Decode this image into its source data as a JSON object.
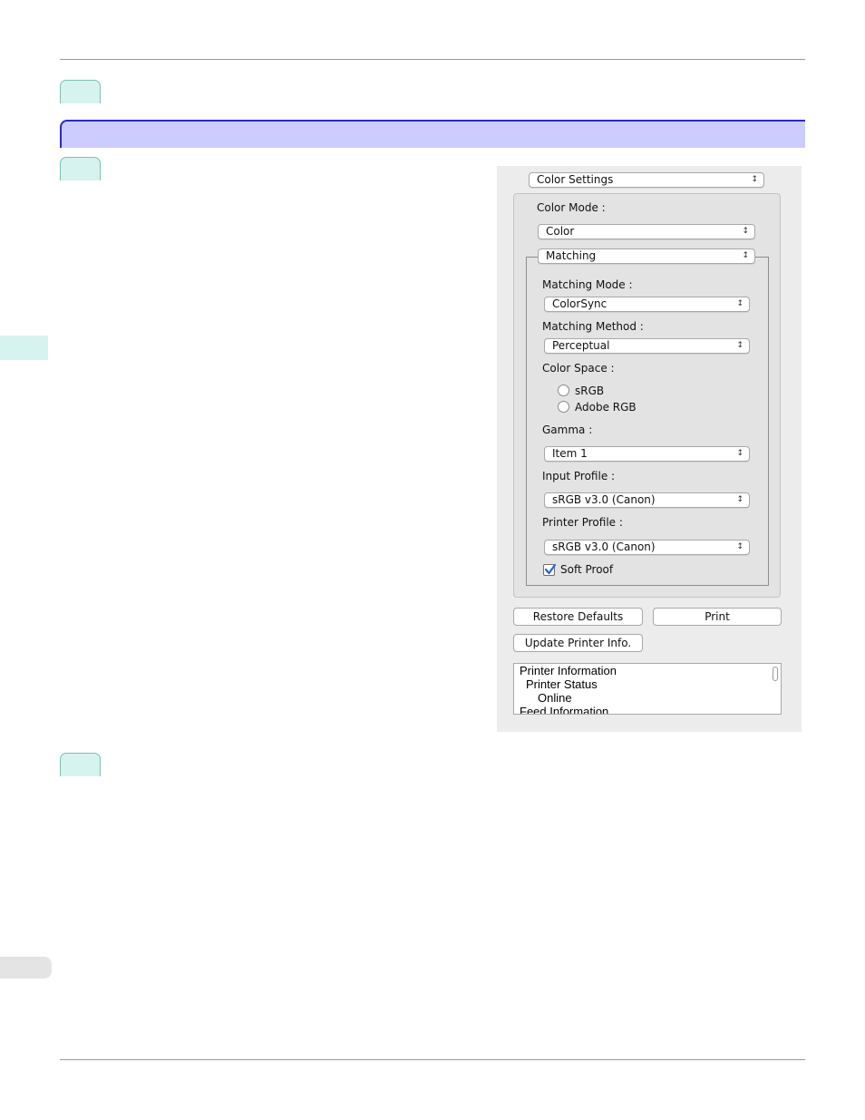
{
  "dialog": {
    "settings_menu": "Color Settings",
    "color_mode_label": "Color Mode :",
    "color_mode_value": "Color",
    "matching_menu": "Matching",
    "matching_mode_label": "Matching Mode :",
    "matching_mode_value": "ColorSync",
    "matching_method_label": "Matching Method :",
    "matching_method_value": "Perceptual",
    "color_space_label": "Color Space :",
    "color_space_options": [
      "sRGB",
      "Adobe RGB"
    ],
    "gamma_label": "Gamma :",
    "gamma_value": "Item 1",
    "input_profile_label": "Input Profile :",
    "input_profile_value": "sRGB v3.0 (Canon)",
    "printer_profile_label": "Printer Profile :",
    "printer_profile_value": "sRGB v3.0 (Canon)",
    "soft_proof_label": "Soft Proof",
    "soft_proof_checked": true,
    "restore_defaults_label": "Restore Defaults",
    "print_label": "Print",
    "update_printer_info_label": "Update Printer Info.",
    "info_lines": [
      "Printer Information",
      "Printer Status",
      "Online",
      "Feed Information"
    ]
  },
  "colors": {
    "section_bar": "#ccccff",
    "section_border": "#2a2acc",
    "step_tab": "#d6f3ef",
    "checkbox_accent": "#2a63c8"
  },
  "icons": {
    "popup_arrow": "updown-arrows-icon",
    "checkmark": "checkmark-icon",
    "radio": "radio-button-icon"
  }
}
